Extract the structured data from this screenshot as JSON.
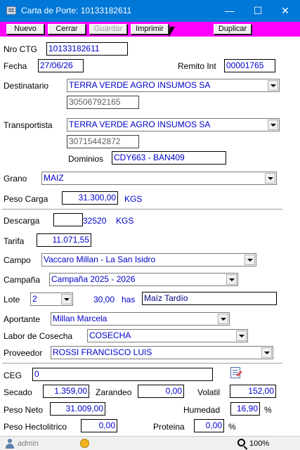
{
  "window": {
    "title": "Carta de Porte: 10133182611"
  },
  "toolbar": {
    "nuevo": "Nuevo",
    "cerrar": "Cerrar",
    "guardar": "Guardar",
    "imprimir": "Imprimir",
    "duplicar": "Duplicar"
  },
  "form": {
    "nro_ctg": {
      "label": "Nro CTG",
      "value": "10133182611"
    },
    "fecha": {
      "label": "Fecha",
      "value": "27/06/26"
    },
    "remito": {
      "label": "Remito Int",
      "value": "00001765"
    },
    "destinatario": {
      "label": "Destinatario",
      "value": "TERRA VERDE AGRO INSUMOS SA",
      "cuit": "30506792165"
    },
    "transportista": {
      "label": "Transportista",
      "value": "TERRA VERDE AGRO INSUMOS SA",
      "cuit": "30715442872"
    },
    "dominios": {
      "label": "Dominios",
      "value": "CDY663 - BAN409"
    },
    "grano": {
      "label": "Grano",
      "value": "MAIZ"
    },
    "peso_carga": {
      "label": "Peso Carga",
      "value": "31.300,00",
      "unit": "KGS"
    },
    "descarga": {
      "label": "Descarga",
      "value": "",
      "value2": "32520",
      "unit": "KGS"
    },
    "tarifa": {
      "label": "Tarifa",
      "value": "11.071,55"
    },
    "campo": {
      "label": "Campo",
      "value": "Vaccaro Millan - La San Isidro"
    },
    "campana": {
      "label": "Campaña",
      "value": "Campaña 2025 - 2026"
    },
    "lote": {
      "label": "Lote",
      "value": "2",
      "has_value": "30,00",
      "has_unit": "has",
      "desc": "Maíz Tardío"
    },
    "aportante": {
      "label": "Aportante",
      "value": "Millan Marcela"
    },
    "labor": {
      "label": "Labor de Cosecha",
      "value": "COSECHA"
    },
    "proveedor": {
      "label": "Proveedor",
      "value": "ROSSI FRANCISCO LUIS"
    },
    "ceg": {
      "label": "CEG",
      "value": "0"
    },
    "secado": {
      "label": "Secado",
      "value": "1.359,00"
    },
    "zarandeo": {
      "label": "Zarandeo",
      "value": "0,00"
    },
    "volatil": {
      "label": "Volatil",
      "value": "152,00"
    },
    "peso_neto": {
      "label": "Peso Neto",
      "value": "31.009,00"
    },
    "humedad": {
      "label": "Humedad",
      "value": "16,90",
      "unit": "%"
    },
    "peso_hecto": {
      "label": "Peso Hectolitrico",
      "value": "0,00"
    },
    "proteina": {
      "label": "Proteina",
      "value": "0,00",
      "unit": "%"
    }
  },
  "status": {
    "user": "admin",
    "zoom": "100%"
  }
}
